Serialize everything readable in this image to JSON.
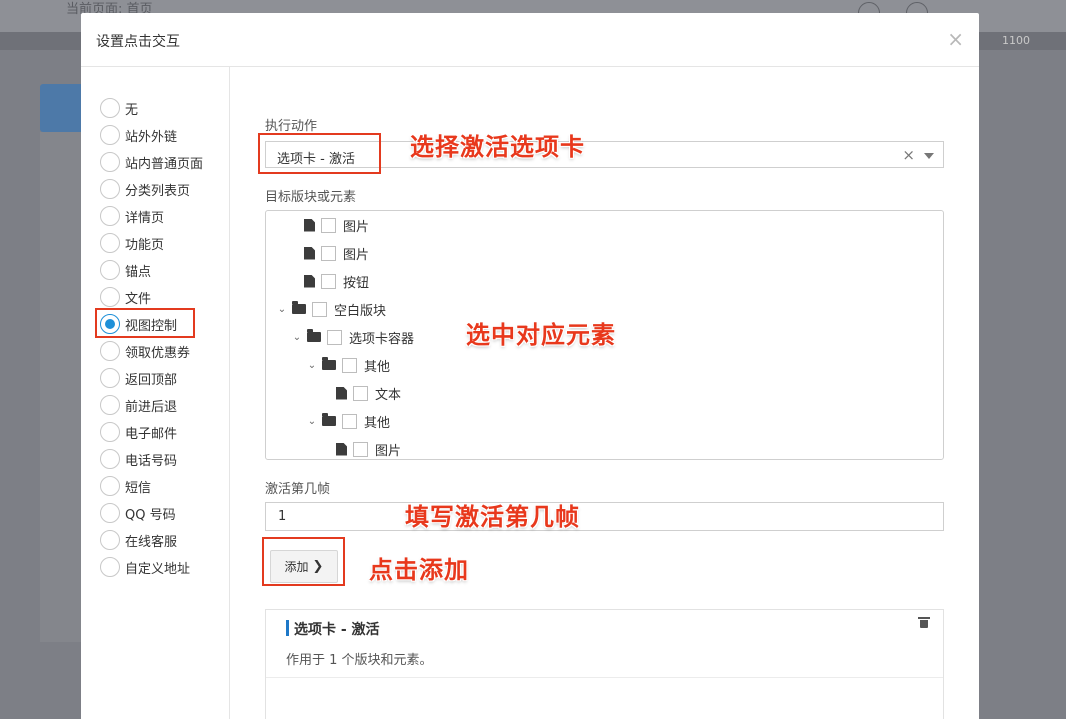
{
  "background": {
    "breadcrumb": "当前页面: 首页",
    "strip_number": "1100"
  },
  "modal": {
    "title": "设置点击交互",
    "close_glyph": "×"
  },
  "link_types": [
    {
      "label": "无",
      "selected": false
    },
    {
      "label": "站外外链",
      "selected": false
    },
    {
      "label": "站内普通页面",
      "selected": false
    },
    {
      "label": "分类列表页",
      "selected": false
    },
    {
      "label": "详情页",
      "selected": false
    },
    {
      "label": "功能页",
      "selected": false
    },
    {
      "label": "锚点",
      "selected": false
    },
    {
      "label": "文件",
      "selected": false
    },
    {
      "label": "视图控制",
      "selected": true
    },
    {
      "label": "领取优惠券",
      "selected": false
    },
    {
      "label": "返回顶部",
      "selected": false
    },
    {
      "label": "前进后退",
      "selected": false
    },
    {
      "label": "电子邮件",
      "selected": false
    },
    {
      "label": "电话号码",
      "selected": false
    },
    {
      "label": "短信",
      "selected": false
    },
    {
      "label": "QQ 号码",
      "selected": false
    },
    {
      "label": "在线客服",
      "selected": false
    },
    {
      "label": "自定义地址",
      "selected": false
    }
  ],
  "action": {
    "label": "执行动作",
    "value": "选项卡 - 激活",
    "clear_glyph": "×"
  },
  "target": {
    "label": "目标版块或元素",
    "tree": [
      {
        "label": "图片",
        "type": "file",
        "caret": ""
      },
      {
        "label": "图片",
        "type": "file",
        "caret": ""
      },
      {
        "label": "按钮",
        "type": "file",
        "caret": ""
      },
      {
        "label": "空白版块",
        "type": "folder",
        "caret": "⌄"
      },
      {
        "label": "选项卡容器",
        "type": "folder",
        "caret": "⌄"
      },
      {
        "label": "其他",
        "type": "folder",
        "caret": "⌄"
      },
      {
        "label": "文本",
        "type": "file",
        "caret": ""
      },
      {
        "label": "其他",
        "type": "folder",
        "caret": "⌄"
      },
      {
        "label": "图片",
        "type": "file",
        "caret": ""
      }
    ]
  },
  "frame": {
    "label": "激活第几帧",
    "value": "1"
  },
  "add_button": {
    "label": "添加",
    "chevron": "❯"
  },
  "added_action": {
    "title": "选项卡 - 激活",
    "description": "作用于 1 个版块和元素。"
  },
  "annotations": {
    "select_action": "选择激活选项卡",
    "select_element": "选中对应元素",
    "fill_frame": "填写激活第几帧",
    "click_add": "点击添加"
  },
  "colors": {
    "accent": "#1e90d8",
    "annotation": "#e8381c",
    "highlight_border": "#e33a1f"
  }
}
